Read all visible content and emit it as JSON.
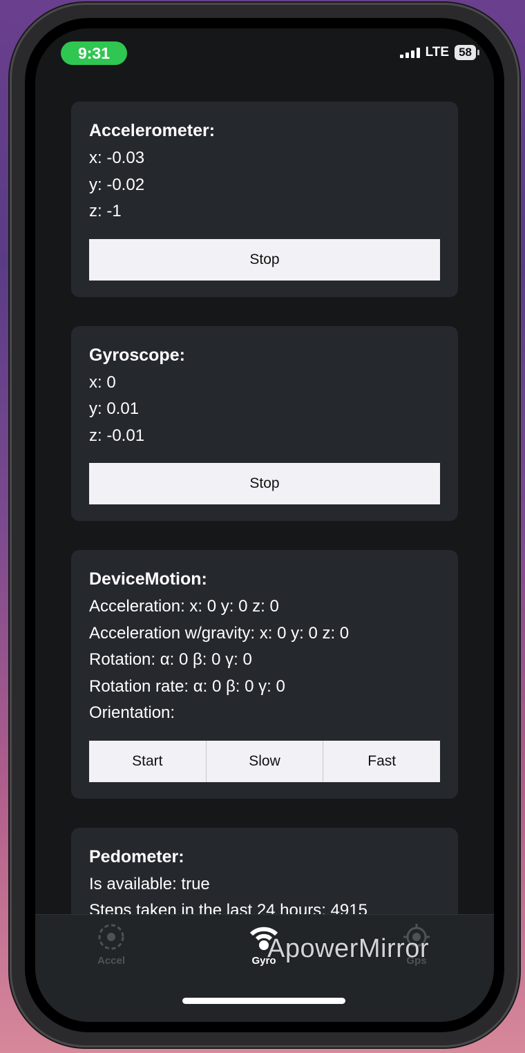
{
  "status_bar": {
    "time": "9:31",
    "network": "LTE",
    "battery": "58"
  },
  "accelerometer": {
    "title": "Accelerometer:",
    "x": "x: -0.03",
    "y": "y: -0.02",
    "z": "z: -1",
    "button": "Stop"
  },
  "gyroscope": {
    "title": "Gyroscope:",
    "x": "x: 0",
    "y": "y: 0.01",
    "z": "z: -0.01",
    "button": "Stop"
  },
  "device_motion": {
    "title": "DeviceMotion:",
    "acceleration": "Acceleration: x: 0 y: 0 z: 0",
    "acceleration_gravity": "Acceleration w/gravity: x: 0 y: 0 z: 0",
    "rotation": "Rotation: α: 0 β: 0 γ: 0",
    "rotation_rate": "Rotation rate: α: 0 β: 0 γ: 0",
    "orientation": "Orientation:",
    "buttons": [
      "Start",
      "Slow",
      "Fast"
    ]
  },
  "pedometer": {
    "title": "Pedometer:",
    "available": "Is available: true",
    "steps": "Steps taken in the last 24 hours: 4915"
  },
  "tabs": [
    {
      "label": "Accel",
      "icon": "accel-icon",
      "active": false
    },
    {
      "label": "Gyro",
      "icon": "gyro-icon",
      "active": true
    },
    {
      "label": "Gps",
      "icon": "gps-icon",
      "active": false
    }
  ],
  "watermark": "ApowerMirror",
  "colors": {
    "background": "#151718",
    "card": "#25282d",
    "button": "#f2f2f6",
    "status_time": "#2fc651",
    "tab_inactive": "#4e5257"
  }
}
